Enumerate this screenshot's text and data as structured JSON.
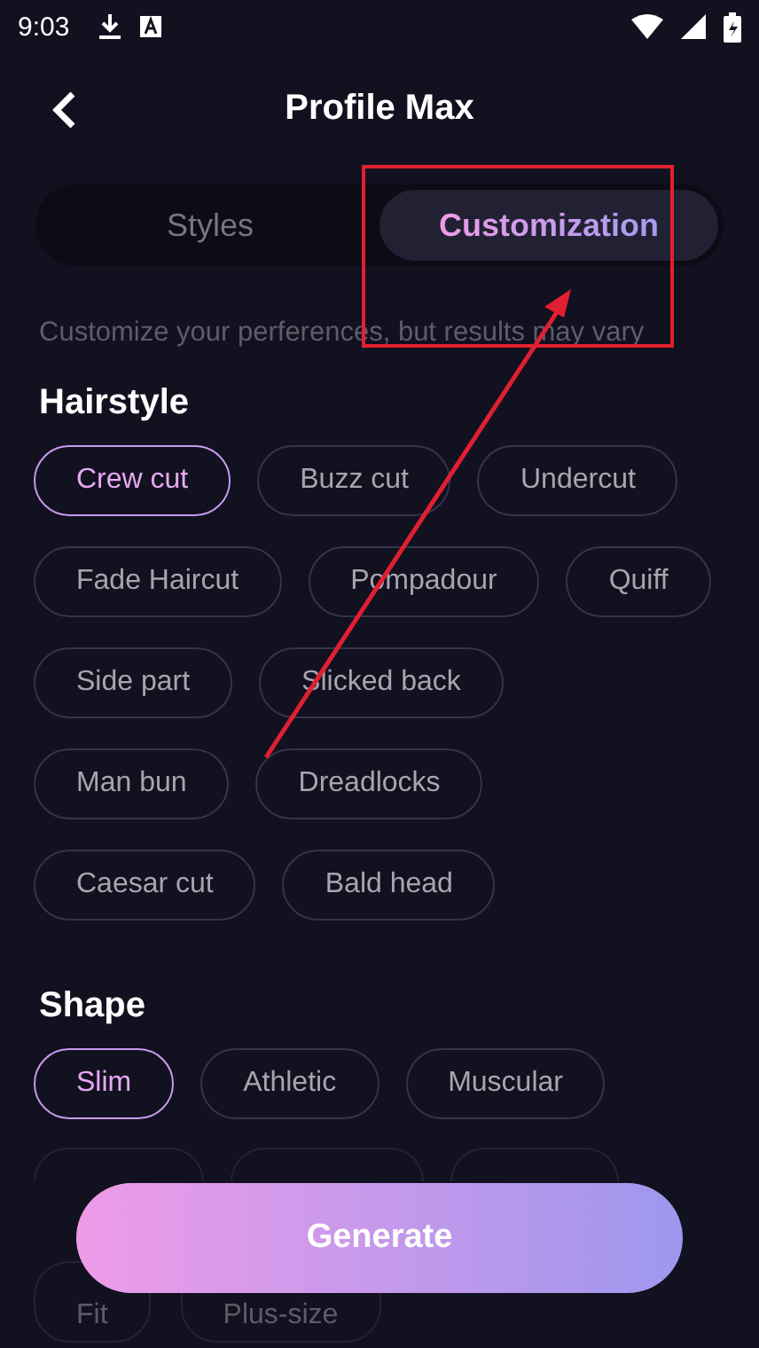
{
  "status_bar": {
    "time": "9:03"
  },
  "header": {
    "title": "Profile Max"
  },
  "tabs": [
    {
      "label": "Styles",
      "selected": false
    },
    {
      "label": "Customization",
      "selected": true
    }
  ],
  "description": "Customize your perferences, but results may vary",
  "sections": [
    {
      "title": "Hairstyle",
      "chips": [
        {
          "label": "Crew cut",
          "selected": true
        },
        {
          "label": "Buzz cut",
          "selected": false
        },
        {
          "label": "Undercut",
          "selected": false
        },
        {
          "label": "Fade Haircut",
          "selected": false
        },
        {
          "label": "Pompadour",
          "selected": false
        },
        {
          "label": "Quiff",
          "selected": false
        },
        {
          "label": "Side part",
          "selected": false
        },
        {
          "label": "Slicked back",
          "selected": false
        },
        {
          "label": "Man bun",
          "selected": false
        },
        {
          "label": "Dreadlocks",
          "selected": false
        },
        {
          "label": "Caesar cut",
          "selected": false
        },
        {
          "label": "Bald head",
          "selected": false
        }
      ]
    },
    {
      "title": "Shape",
      "chips": [
        {
          "label": "Slim",
          "selected": true
        },
        {
          "label": "Athletic",
          "selected": false
        },
        {
          "label": "Muscular",
          "selected": false
        }
      ],
      "lower_chips": [
        {
          "label": "Fit",
          "selected": false
        },
        {
          "label": "Plus-size",
          "selected": false
        }
      ]
    }
  ],
  "generate_button": {
    "label": "Generate"
  }
}
